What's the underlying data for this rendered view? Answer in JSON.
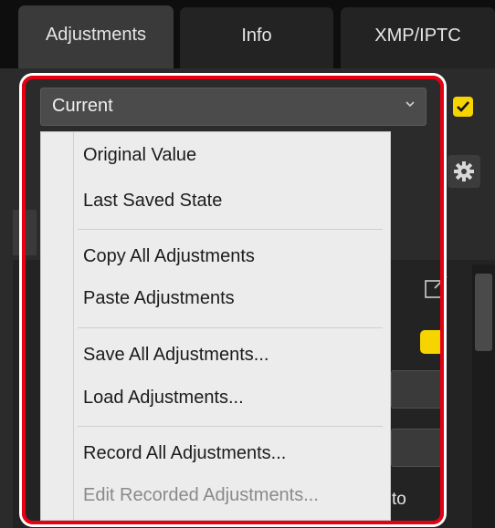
{
  "tabs": [
    {
      "label": "Adjustments",
      "active": true
    },
    {
      "label": "Info",
      "active": false
    },
    {
      "label": "XMP/IPTC",
      "active": false
    }
  ],
  "select": {
    "value": "Current"
  },
  "menu": {
    "items": [
      {
        "label": "Original Value",
        "enabled": true
      },
      {
        "label": "Last Saved State",
        "enabled": true
      },
      {
        "label": "Copy All Adjustments",
        "enabled": true
      },
      {
        "label": "Paste Adjustments",
        "enabled": true
      },
      {
        "label": "Save All Adjustments...",
        "enabled": true
      },
      {
        "label": "Load Adjustments...",
        "enabled": true
      },
      {
        "label": "Record All Adjustments...",
        "enabled": true
      },
      {
        "label": "Edit Recorded Adjustments...",
        "enabled": false
      }
    ]
  },
  "background_peek_text": "to",
  "colors": {
    "highlight": "#e60012",
    "accent_yellow": "#f5d400",
    "menu_bg": "#ececec"
  }
}
